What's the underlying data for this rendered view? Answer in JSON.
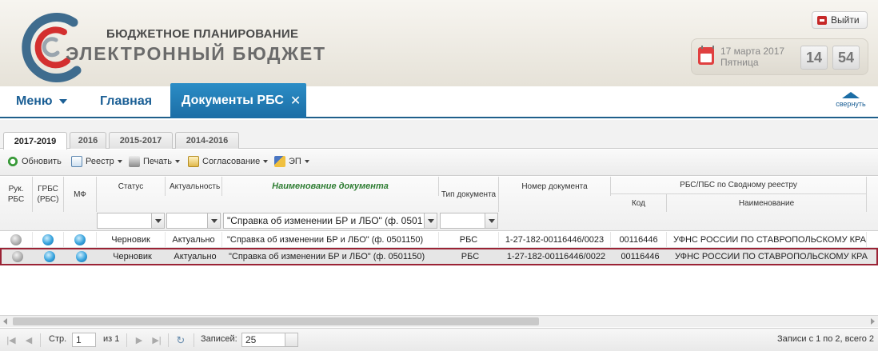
{
  "header": {
    "brand_sub": "БЮДЖЕТНОЕ ПЛАНИРОВАНИЕ",
    "brand_main": "ЭЛЕКТРОННЫЙ БЮДЖЕТ",
    "logout_label": "Выйти",
    "date": "17 марта 2017",
    "weekday": "Пятница",
    "hour": "14",
    "minute": "54"
  },
  "nav": {
    "menu_label": "Меню",
    "home_label": "Главная",
    "active_tab": "Документы РБС",
    "active_tab_close": "✕",
    "collapse_label": "свернуть"
  },
  "year_tabs": [
    "2017-2019",
    "2016",
    "2015-2017",
    "2014-2016"
  ],
  "toolbar": {
    "refresh": "Обновить",
    "registry": "Реестр",
    "print": "Печать",
    "approval": "Согласование",
    "ep": "ЭП"
  },
  "grid": {
    "headers": {
      "ruk_rbs": "Рук. РБС",
      "grbs": "ГРБС (РБС)",
      "mf": "МФ",
      "status": "Статус",
      "actuality": "Актуальность",
      "doc_name": "Наименование документа",
      "doc_type": "Тип документа",
      "doc_number": "Номер документа",
      "group": "РБС/ПБС по Сводному реестру",
      "code": "Код",
      "name": "Наименование"
    },
    "filters": {
      "status": "",
      "actuality": "",
      "doc_name": "\"Справка об изменении БР и ЛБО\" (ф. 0501",
      "doc_type": ""
    },
    "rows": [
      {
        "ruk": "gray",
        "grbs": "blue",
        "mf": "blue",
        "status": "Черновик",
        "actuality": "Актуально",
        "doc_name": "\"Справка об изменении БР и ЛБО\" (ф. 0501150)",
        "doc_type": "РБС",
        "doc_number": "1-27-182-00116446/0023",
        "code": "00116446",
        "name": "УФНС РОССИИ ПО СТАВРОПОЛЬСКОМУ КРАЮ",
        "selected": false
      },
      {
        "ruk": "gray",
        "grbs": "blue",
        "mf": "blue",
        "status": "Черновик",
        "actuality": "Актуально",
        "doc_name": "\"Справка об изменении БР и ЛБО\" (ф. 0501150)",
        "doc_type": "РБС",
        "doc_number": "1-27-182-00116446/0022",
        "code": "00116446",
        "name": "УФНС РОССИИ ПО СТАВРОПОЛЬСКОМУ КРАЮ",
        "selected": true
      }
    ]
  },
  "pager": {
    "page_label": "Стр.",
    "page": "1",
    "of_label": "из 1",
    "records_label": "Записей:",
    "page_size": "25",
    "summary": "Записи с 1 по 2, всего 2"
  },
  "colors": {
    "accent": "#1b6da5",
    "title_green": "#2e7d32",
    "selection_border": "#9b2335"
  }
}
